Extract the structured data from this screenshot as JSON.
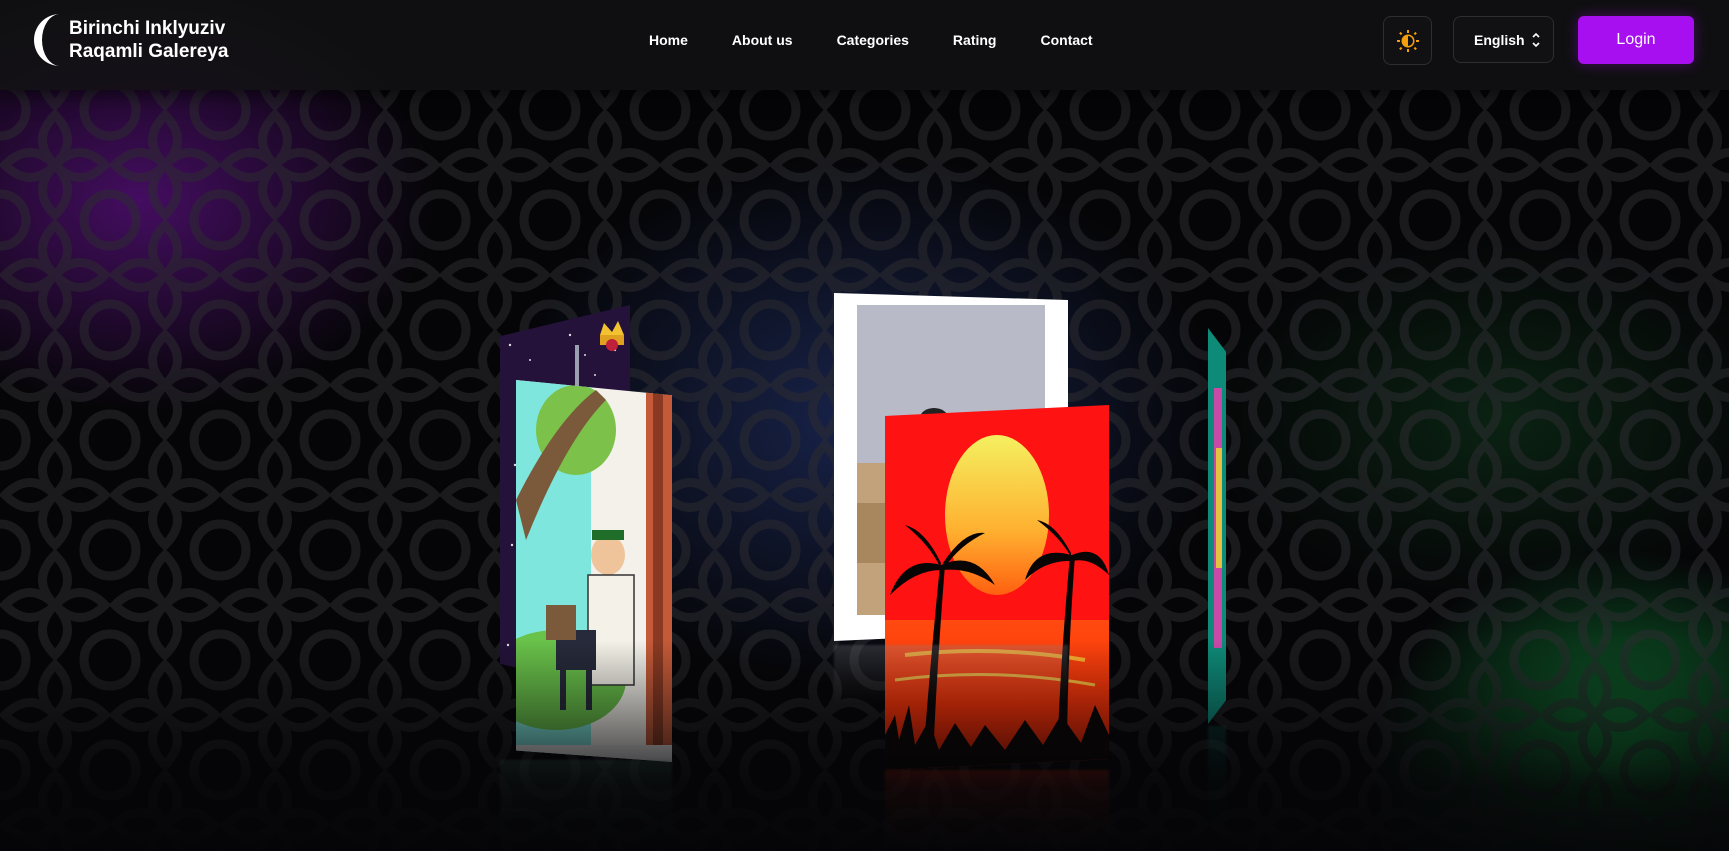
{
  "header": {
    "brand_line1": "Birinchi Inklyuziv",
    "brand_line2": "Raqamli Galereya",
    "nav": [
      {
        "label": "Home"
      },
      {
        "label": "About us"
      },
      {
        "label": "Categories"
      },
      {
        "label": "Rating"
      },
      {
        "label": "Contact"
      }
    ],
    "theme_icon": "sun-moon-icon",
    "language": {
      "selected": "English",
      "icon": "chevron-up-down-icon"
    },
    "login_label": "Login"
  },
  "colors": {
    "accent": "#a80ff0",
    "header_bg": "#121214",
    "theme_icon": "#f59e0b",
    "glow_purple": "#7814aa",
    "glow_green": "#14aa46",
    "glow_blue": "#283c82"
  },
  "gallery": {
    "artworks": [
      {
        "subject": "purple-starry-painting-with-crown-icon"
      },
      {
        "subject": "cartoon-man-with-donkey-painting"
      },
      {
        "subject": "framed-photograph"
      },
      {
        "subject": "red-sunset-palm-trees-painting"
      },
      {
        "subject": "teal-colorful-painting-edge"
      }
    ]
  }
}
